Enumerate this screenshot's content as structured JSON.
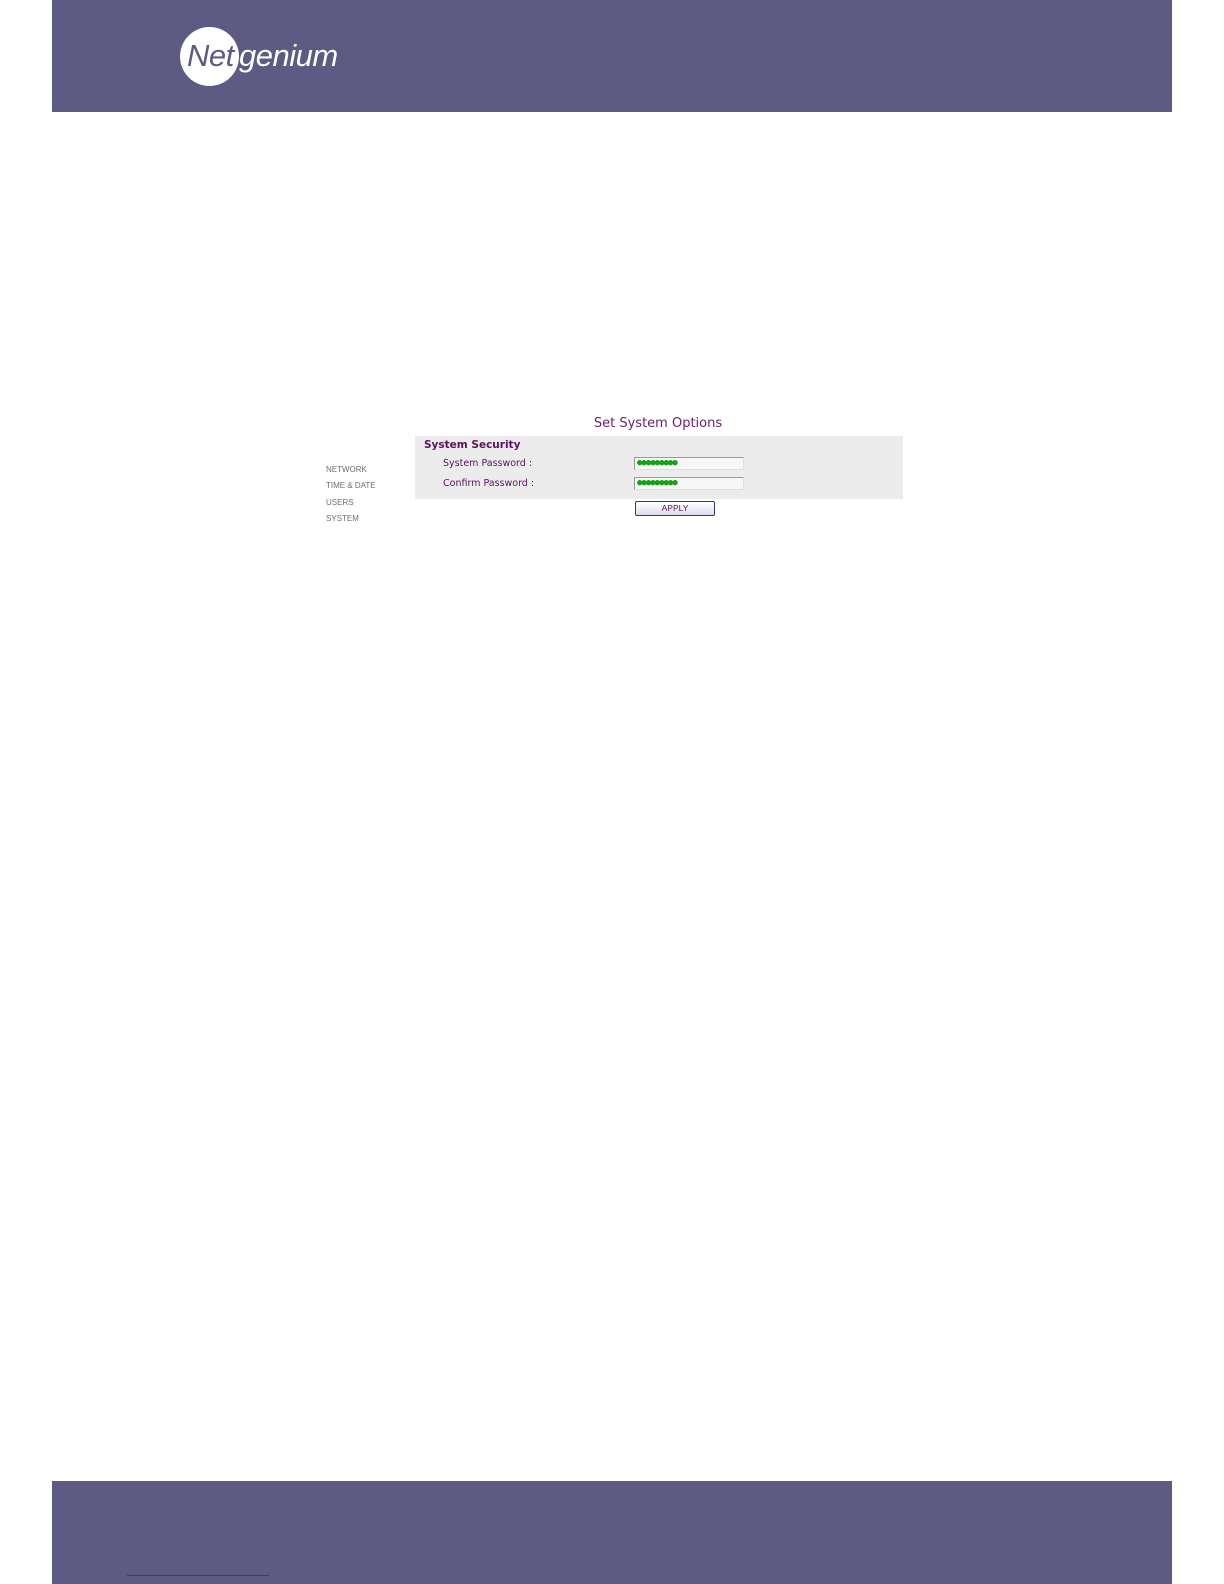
{
  "brand": {
    "part1": "Net",
    "part2": "genium",
    "color_band": "#5d5b83",
    "color_accent": "#6a1f6e"
  },
  "page": {
    "title": "Set System Options"
  },
  "nav": {
    "items": [
      {
        "label": "NETWORK"
      },
      {
        "label": "TIME & DATE"
      },
      {
        "label": "USERS"
      },
      {
        "label": "SYSTEM"
      }
    ]
  },
  "security": {
    "section_title": "System Security",
    "password_label": "System Password :",
    "password_value": "●●●●●●●●●",
    "confirm_label": "Confirm Password :",
    "confirm_value": "●●●●●●●●●",
    "apply_label": "APPLY"
  }
}
